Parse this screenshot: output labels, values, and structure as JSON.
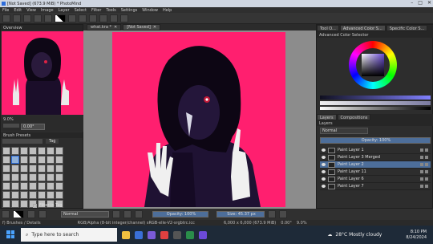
{
  "window": {
    "title": "[Not Saved] (673.9 MiB) * PhotoMind",
    "minimize": "–",
    "maximize": "□",
    "close": "✕"
  },
  "menu": [
    "File",
    "Edit",
    "View",
    "Image",
    "Layer",
    "Select",
    "Filter",
    "Tools",
    "Settings",
    "Window",
    "Help"
  ],
  "left": {
    "overview_title": "Overview",
    "zoom": "9.0%",
    "angle": "0.00°",
    "brush_presets_title": "Brush Presets",
    "tag": "Tag",
    "filter_tag": "Filter in Tag"
  },
  "tabs": [
    {
      "label": "what.kra *"
    },
    {
      "label": "[Not Saved]"
    }
  ],
  "right": {
    "tabs_top": [
      "Tool O...",
      "Advanced Color S...",
      "Specific Color S..."
    ],
    "color_selector_title": "Advanced Color Selector",
    "layers_tabs": [
      "Layers",
      "Compositions"
    ],
    "layers_title": "Layers",
    "blend_mode": "Normal",
    "opacity_label": "Opacity: 100%",
    "layers": [
      {
        "name": "Paint Layer 1",
        "active": false
      },
      {
        "name": "Paint Layer 3 Merged",
        "active": false
      },
      {
        "name": "Paint Layer 2",
        "active": true
      },
      {
        "name": "Paint Layer 11",
        "active": false
      },
      {
        "name": "Paint Layer 6",
        "active": false
      },
      {
        "name": "Paint Layer 7",
        "active": false
      }
    ]
  },
  "statusbar": {
    "blend": "Normal",
    "opacity": "Opacity: 100%",
    "size": "Size: 45.37 px",
    "rotation": "0.00°",
    "zoom": "9.0%"
  },
  "info": {
    "left": "f) Brushes / Details",
    "mid": "RGB/Alpha (8-bit integer/channel) sRGB-elle-V2-srgbtrc.icc",
    "dims": "6,000 x 6,000 (673.9 MiB)"
  },
  "taskbar": {
    "search_placeholder": "Type here to search",
    "weather": "28°C Mostly cloudy",
    "time": "8:10 PM",
    "date": "8/24/2024"
  },
  "colors": {
    "canvas_bg": "#ff1f6f",
    "accent": "#5577aa"
  }
}
